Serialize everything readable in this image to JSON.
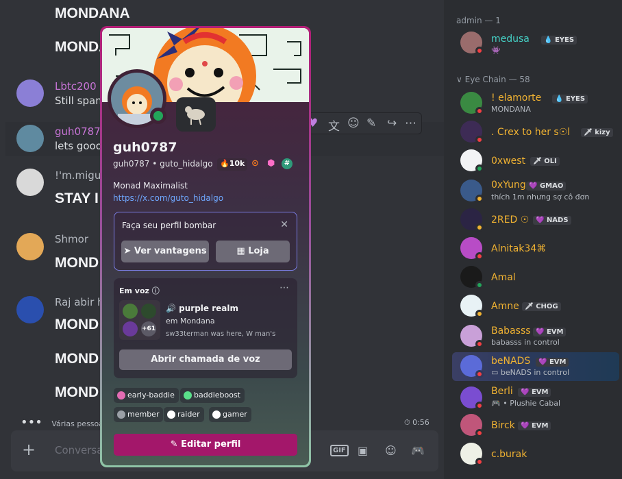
{
  "chat": {
    "msgs": [
      {
        "text": "MONDANA"
      },
      {
        "text": "MONDANA"
      }
    ],
    "lbtc": {
      "user": "Lbtc200",
      "text": "Still spam"
    },
    "guh": {
      "user": "guh0787",
      "text": "lets goooo"
    },
    "miguel": {
      "user": "!'m.migue",
      "text": "STAY I"
    },
    "shmor": {
      "user": "Shmor",
      "text": "MOND"
    },
    "raj": {
      "user": "Raj abir h",
      "texts": [
        "MOND",
        "MOND",
        "MOND"
      ]
    },
    "typing": "Várias pessoa",
    "timer": "0:56",
    "composer_placeholder": "Conversar"
  },
  "members": {
    "admin_header": "admin — 1",
    "eyechain_header": "Eye Chain — 58",
    "list": [
      {
        "name": "medusa",
        "tag": "EYES",
        "color": "#45d1c6"
      },
      {
        "name": "! elamorte",
        "tag": "EYES",
        "sub": "MONDANA",
        "color": "#f0b232"
      },
      {
        "name": ". Crex to her s☉l",
        "tag": "kizy",
        "color": "#f0b232"
      },
      {
        "name": "0xwest",
        "tag": "OLI",
        "color": "#f0b232"
      },
      {
        "name": "0xYung",
        "tag": "GMAO",
        "sub": "thích 1m nhưng sợ cô đơn",
        "color": "#f0b232"
      },
      {
        "name": "2RED ☉",
        "tag": "NADS",
        "color": "#f0b232"
      },
      {
        "name": "Alnitak34⌘",
        "color": "#f0b232"
      },
      {
        "name": "Amal",
        "color": "#f0b232"
      },
      {
        "name": "Amne",
        "tag": "CHOG",
        "color": "#f0b232"
      },
      {
        "name": "Babasss",
        "tag": "EVM",
        "sub": "babasss in control",
        "color": "#f0b232"
      },
      {
        "name": "beNADS",
        "tag": "EVM",
        "sub": "beNADS in control",
        "color": "#f0b232"
      },
      {
        "name": "Berli",
        "tag": "EVM",
        "sub": "Plushie Cabal",
        "color": "#f0b232"
      },
      {
        "name": "Birck",
        "tag": "EVM",
        "color": "#f0b232"
      },
      {
        "name": "c.burak",
        "color": "#f0b232"
      }
    ]
  },
  "profile": {
    "display_name": "guh0787",
    "handle": "guh0787",
    "separator": "•",
    "pronoun_tag": "guto_hidalgo",
    "badge_count": "10k",
    "bio": "Monad Maximalist",
    "link": "https://x.com/guto_hidalgo",
    "nitro_title": "Faça seu perfil bombar",
    "btn_perks": "Ver vantagens",
    "btn_shop": "Loja",
    "voice_label": "Em voz",
    "voice_channel": "purple realm",
    "voice_server": "em Mondana",
    "voice_status": "sw33terman was here, W man's",
    "voice_more": "+61",
    "voice_button": "Abrir chamada de voz",
    "roles": [
      {
        "name": "early-baddie",
        "color": "#e36cb3"
      },
      {
        "name": "baddieboost",
        "color": "#5ae08a"
      },
      {
        "name": "member",
        "color": "#9aa0a6"
      },
      {
        "name": "raider",
        "color": "#ffffff"
      },
      {
        "name": "gamer",
        "color": "#ffffff"
      }
    ],
    "edit_button": "Editar perfil"
  }
}
